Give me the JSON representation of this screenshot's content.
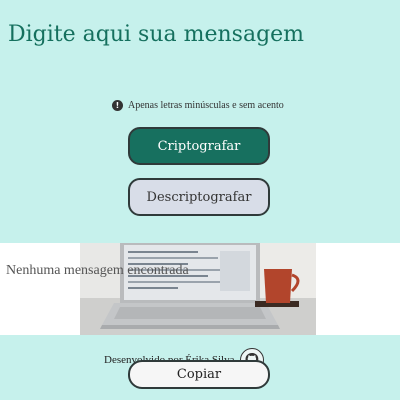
{
  "input": {
    "placeholder": "Digite aqui sua mensagem",
    "value": ""
  },
  "hint": {
    "icon": "info-icon",
    "text": "Apenas letras minúsculas e sem acento"
  },
  "buttons": {
    "encrypt": "Criptografar",
    "decrypt": "Descriptografar",
    "copy": "Copiar"
  },
  "output": {
    "empty_message": "Nenhuma mensagem encontrada",
    "illustration": "laptop-mug-illustration"
  },
  "footer": {
    "credit": "Desenvolvido por Érika Silva",
    "icon": "github-icon"
  },
  "colors": {
    "background": "#c6f1ec",
    "primary": "#17705f",
    "secondary": "#d8dde8",
    "title": "#15705e"
  }
}
